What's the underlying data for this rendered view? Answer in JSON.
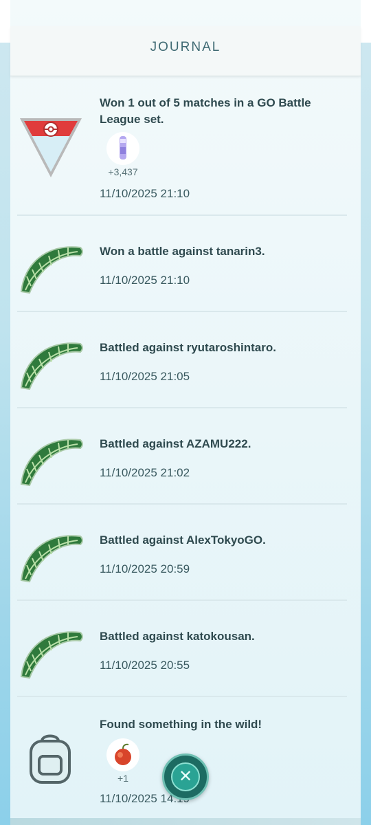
{
  "header": {
    "title": "JOURNAL"
  },
  "entries": [
    {
      "icon": "battle-league-icon",
      "text": "Won 1 out of 5 matches in a GO Battle League set.",
      "reward": {
        "icon": "stardust-icon",
        "count": "+3,437"
      },
      "date": "11/10/2025 21:10"
    },
    {
      "icon": "leaf-icon",
      "text": "Won a battle against tanarin3.",
      "date": "11/10/2025 21:10"
    },
    {
      "icon": "leaf-icon",
      "text": "Battled against ryutaroshintaro.",
      "date": "11/10/2025 21:05"
    },
    {
      "icon": "leaf-icon",
      "text": "Battled against AZAMU222.",
      "date": "11/10/2025 21:02"
    },
    {
      "icon": "leaf-icon",
      "text": "Battled against AlexTokyoGO.",
      "date": "11/10/2025 20:59"
    },
    {
      "icon": "leaf-icon",
      "text": "Battled against katokousan.",
      "date": "11/10/2025 20:55"
    },
    {
      "icon": "backpack-icon",
      "text": "Found something in the wild!",
      "reward": {
        "icon": "razz-berry-icon",
        "count": "+1"
      },
      "date": "11/10/2025 14:19"
    }
  ],
  "close_button": {
    "icon": "close-icon",
    "symbol": "✕"
  },
  "colors": {
    "accent": "#2aa394",
    "text": "#2f4a4f",
    "title": "#3f6a73"
  }
}
